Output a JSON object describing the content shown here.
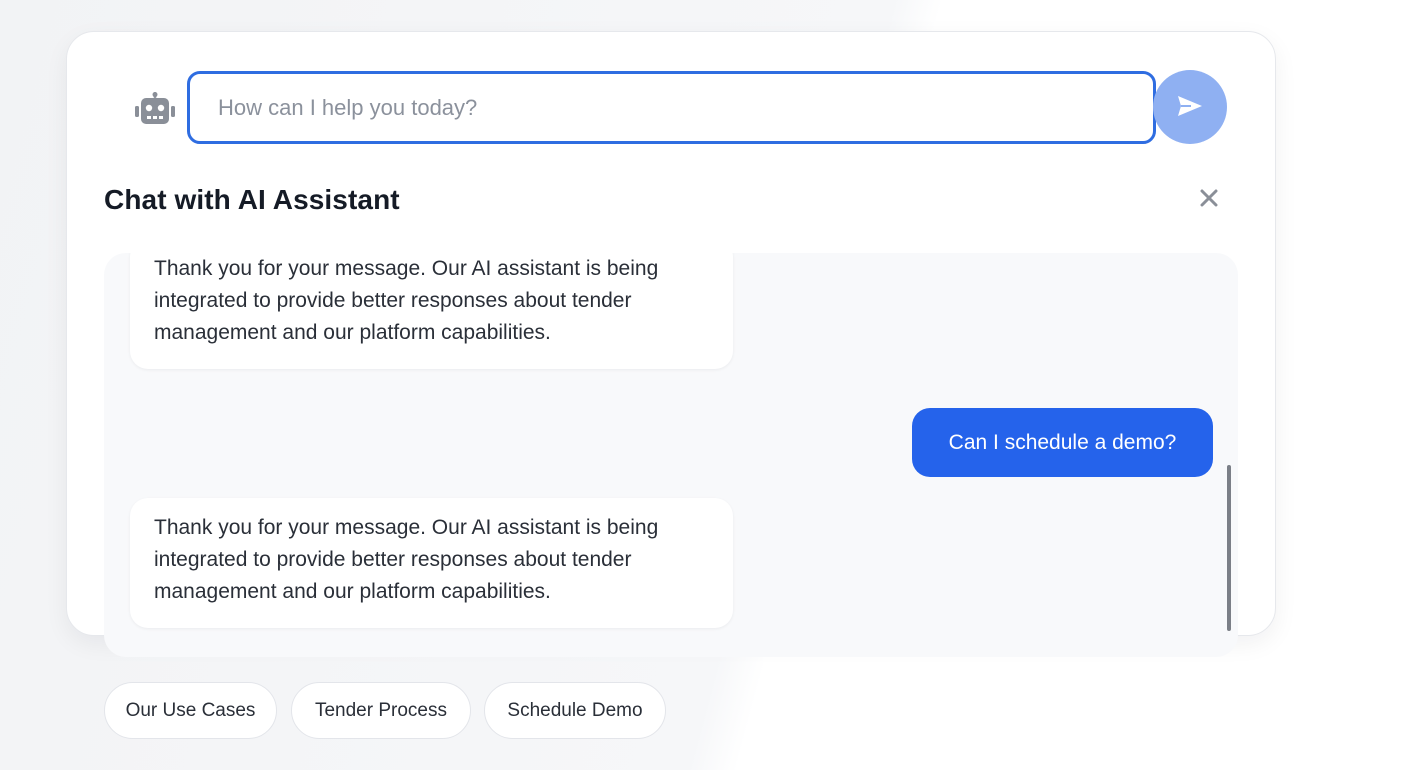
{
  "composer": {
    "placeholder": "How can I help you today?",
    "value": ""
  },
  "icons": {
    "assistant": "robot-icon",
    "send": "send-icon",
    "close": "close-icon"
  },
  "header": {
    "title": "Chat with AI Assistant"
  },
  "messages": [
    {
      "role": "assistant",
      "text": "Thank you for your message. Our AI assistant is being integrated to provide better responses about tender management and our platform capabilities."
    },
    {
      "role": "user",
      "text": "Can I schedule a demo?"
    },
    {
      "role": "assistant",
      "text": "Thank you for your message. Our AI assistant is being integrated to provide better responses about tender management and our platform capabilities."
    }
  ],
  "quick_replies": [
    {
      "label": "Our Use Cases"
    },
    {
      "label": "Tender Process"
    },
    {
      "label": "Schedule Demo"
    }
  ],
  "colors": {
    "accent": "#2563eb",
    "input_border": "#2f6de1",
    "send_button": "#8fb0f2",
    "panel_bg": "#f8f9fb"
  }
}
